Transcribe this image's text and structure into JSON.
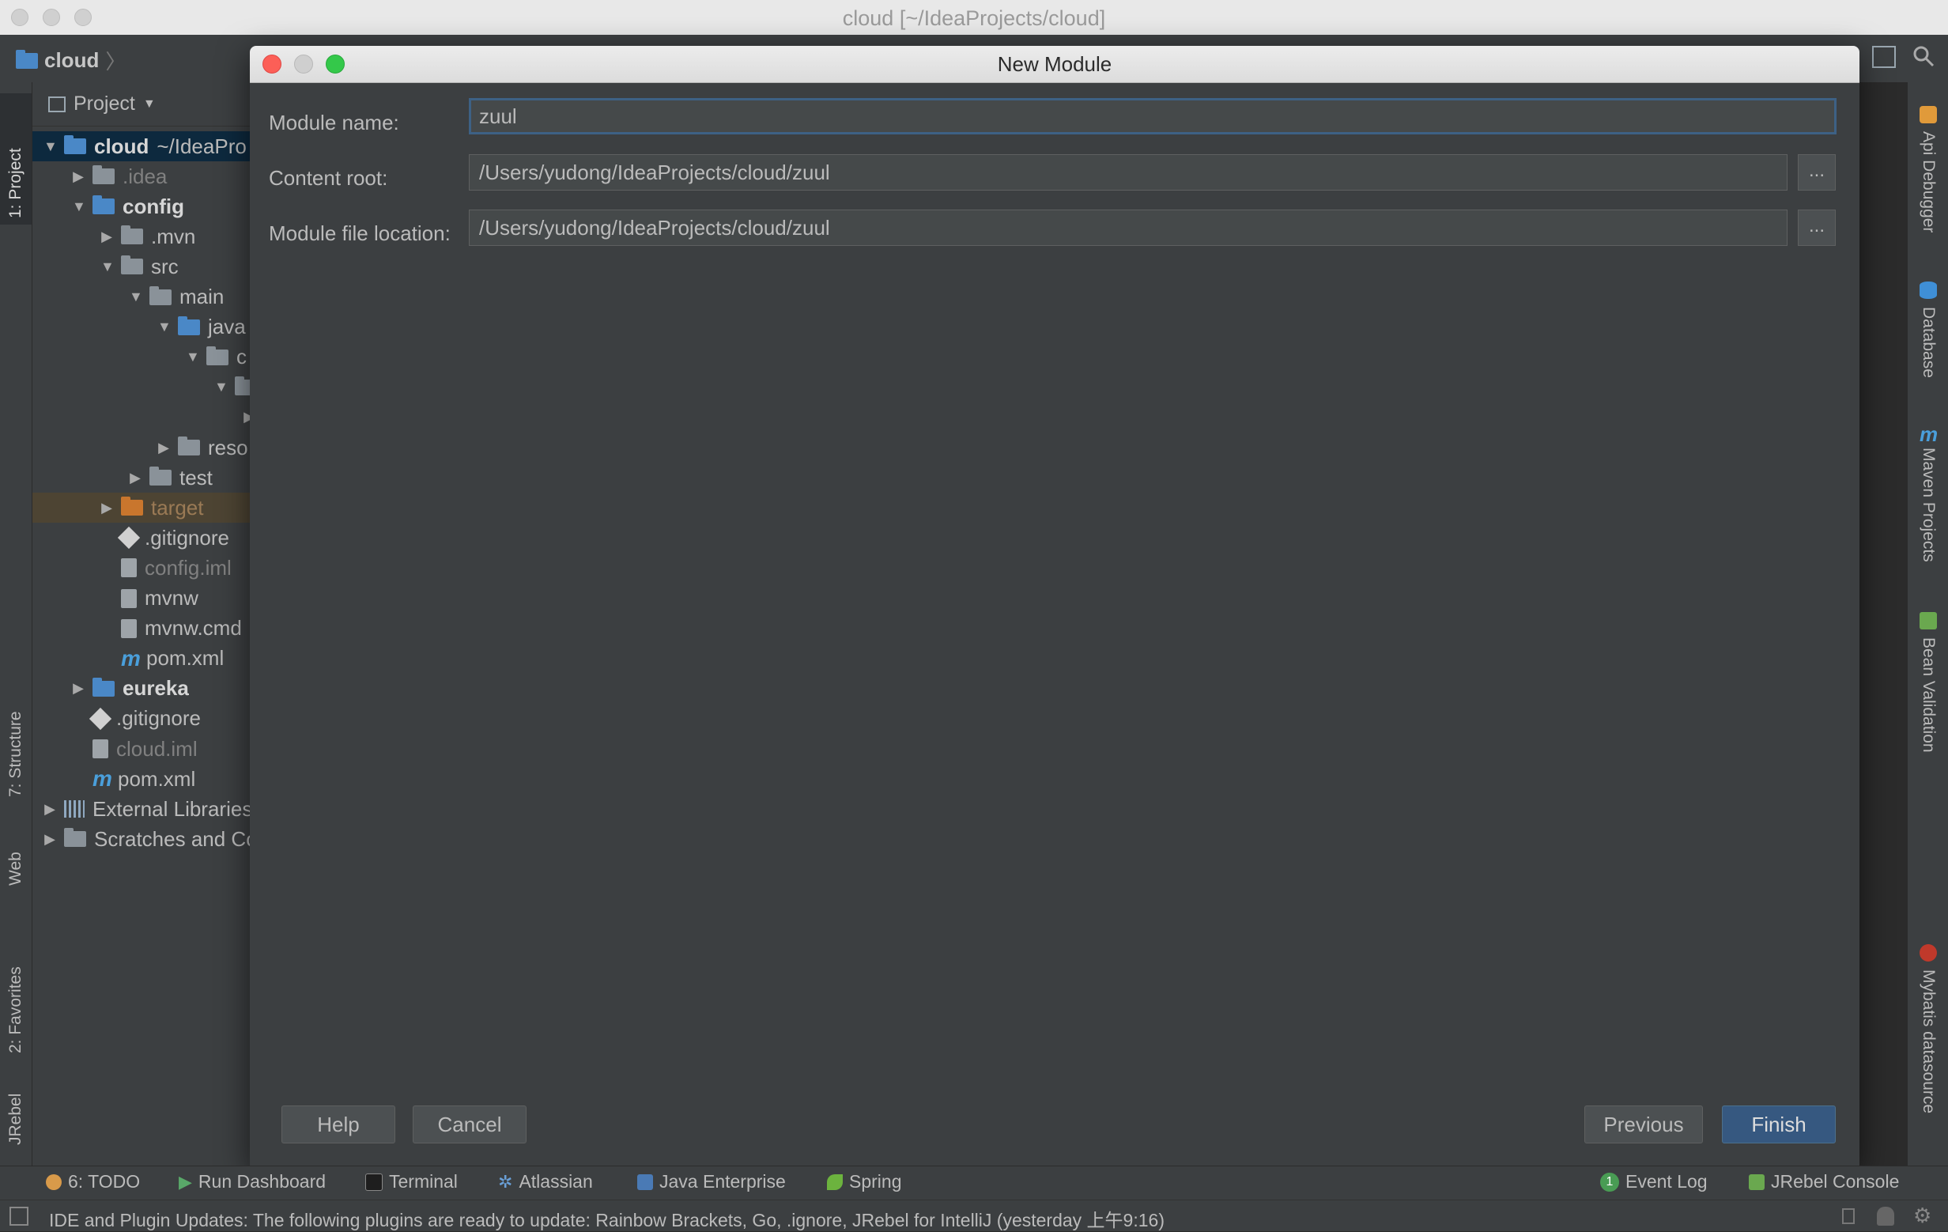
{
  "window": {
    "title": "cloud [~/IdeaProjects/cloud]"
  },
  "navbar": {
    "project": "cloud"
  },
  "left_tabs": [
    "1: Project",
    "7: Structure",
    "Web",
    "2: Favorites",
    "JRebel"
  ],
  "right_tabs": [
    "Api Debugger",
    "Database",
    "Maven Projects",
    "Bean Validation",
    "Mybatis datasource"
  ],
  "project_panel": {
    "header": "Project",
    "tree": [
      {
        "label": "cloud",
        "extra": "~/IdeaPro",
        "icon": "folder-module-icon",
        "arrow": "▼",
        "style": "bold selected"
      },
      {
        "label": ".idea",
        "icon": "folder-icon",
        "arrow": "▶",
        "style": "dim"
      },
      {
        "label": "config",
        "icon": "folder-module-icon",
        "arrow": "▼",
        "style": "bold"
      },
      {
        "label": ".mvn",
        "icon": "folder-icon",
        "arrow": "▶",
        "style": ""
      },
      {
        "label": "src",
        "icon": "folder-icon",
        "arrow": "▼",
        "style": ""
      },
      {
        "label": "main",
        "icon": "folder-icon",
        "arrow": "▼",
        "style": ""
      },
      {
        "label": "java",
        "icon": "folder-source-icon",
        "arrow": "▼",
        "style": ""
      },
      {
        "label": "c",
        "icon": "package-icon",
        "arrow": "▼",
        "style": ""
      },
      {
        "label": "",
        "icon": "package-icon",
        "arrow": "▼",
        "style": ""
      },
      {
        "label": "",
        "icon": "",
        "arrow": "▶",
        "style": ""
      },
      {
        "label": "reso",
        "icon": "folder-resources-icon",
        "arrow": "▶",
        "style": ""
      },
      {
        "label": "test",
        "icon": "folder-icon",
        "arrow": "▶",
        "style": ""
      },
      {
        "label": "target",
        "icon": "folder-excluded-icon",
        "arrow": "▶",
        "style": "orange highlighted"
      },
      {
        "label": ".gitignore",
        "icon": "gitignore-icon",
        "arrow": "",
        "style": ""
      },
      {
        "label": "config.iml",
        "icon": "iml-file-icon",
        "arrow": "",
        "style": "dim"
      },
      {
        "label": "mvnw",
        "icon": "file-icon",
        "arrow": "",
        "style": ""
      },
      {
        "label": "mvnw.cmd",
        "icon": "file-icon",
        "arrow": "",
        "style": ""
      },
      {
        "label": "pom.xml",
        "icon": "maven-icon",
        "arrow": "",
        "style": ""
      },
      {
        "label": "eureka",
        "icon": "folder-module-icon",
        "arrow": "▶",
        "style": "bold"
      },
      {
        "label": ".gitignore",
        "icon": "gitignore-icon",
        "arrow": "",
        "style": ""
      },
      {
        "label": "cloud.iml",
        "icon": "iml-file-icon",
        "arrow": "",
        "style": "dim"
      },
      {
        "label": "pom.xml",
        "icon": "maven-icon",
        "arrow": "",
        "style": ""
      },
      {
        "label": "External Libraries",
        "icon": "libraries-icon",
        "arrow": "▶",
        "style": ""
      },
      {
        "label": "Scratches and Consoles",
        "icon": "scratches-icon",
        "arrow": "▶",
        "style": ""
      }
    ]
  },
  "dialog": {
    "title": "New Module",
    "module_name_label": "Module name:",
    "module_name_value": "zuul",
    "content_root_label": "Content root:",
    "content_root_value": "/Users/yudong/IdeaProjects/cloud/zuul",
    "file_location_label": "Module file location:",
    "file_location_value": "/Users/yudong/IdeaProjects/cloud/zuul",
    "browse_label": "...",
    "help_label": "Help",
    "cancel_label": "Cancel",
    "previous_label": "Previous",
    "finish_label": "Finish"
  },
  "bottom_toolbar": {
    "todo": "6: TODO",
    "run_dashboard": "Run Dashboard",
    "terminal": "Terminal",
    "atlassian": "Atlassian",
    "java_enterprise": "Java Enterprise",
    "spring": "Spring",
    "event_log": "Event Log",
    "event_log_count": "1",
    "jrebel_console": "JRebel Console"
  },
  "status": {
    "text": "IDE and Plugin Updates: The following plugins are ready to update: Rainbow Brackets, Go, .ignore, JRebel for IntelliJ (yesterday 上午9:16)"
  },
  "colors": {
    "accent": "#365880",
    "selection": "#0d293e",
    "focus": "#3d6185"
  }
}
